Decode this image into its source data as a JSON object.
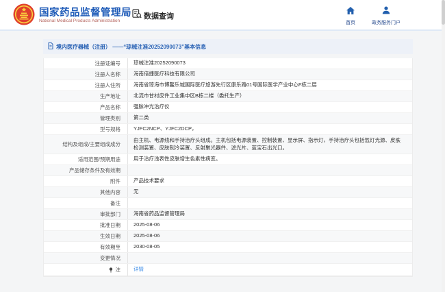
{
  "header": {
    "brand": {
      "title": "国家药品监督管理局",
      "subtitle": "National Medical Products Administration",
      "emblem_icon": "china-national-emblem"
    },
    "data_query": {
      "label": "数据查询",
      "icon": "doc-search-icon"
    },
    "nav": [
      {
        "label": "首页",
        "icon": "home-icon"
      },
      {
        "label": "政务服务门户",
        "icon": "user-icon"
      }
    ]
  },
  "breadcrumb": {
    "icon": "document-icon",
    "text": "境内医疗器械（注册） ——“琼械注准20252090073”基本信息"
  },
  "table": {
    "rows": [
      {
        "label": "注册证编号",
        "value": "琼械注准20252090073"
      },
      {
        "label": "注册人名称",
        "value": "海南倍捷医疗科技有限公司"
      },
      {
        "label": "注册人住所",
        "value": "海南省琼海市博鳌乐城国际医疗旅游先行区康乐路01号国际医学产业中心F栋二层"
      },
      {
        "label": "生产地址",
        "value": "北流市甘村皮件工业集中区B栋二楼（委托生产）"
      },
      {
        "label": "产品名称",
        "value": "强脉冲光治疗仪"
      },
      {
        "label": "管理类别",
        "value": "第二类"
      },
      {
        "label": "型号规格",
        "value": "YJFC2NCP、YJFC2DCP，"
      },
      {
        "label": "结构及组成/主要组成成分",
        "value": "由主机、电源线和手持治疗头组成。主机包括电源装置、控制装置、显示屏、指示灯，手持治疗头包括氙灯光源、皮肤检测装置、皮肤制冷装置、反射聚光器件、滤光片、蓝宝石出光口。",
        "tall": true
      },
      {
        "label": "适用范围/预期用途",
        "value": "用于治疗浅表性皮肤增生色素性病变。"
      },
      {
        "label": "产品储存条件及有效期",
        "value": ""
      },
      {
        "label": "附件",
        "value": "产品技术要求"
      },
      {
        "label": "其他内容",
        "value": "无"
      },
      {
        "label": "备注",
        "value": ""
      },
      {
        "label": "审批部门",
        "value": "海南省药品监督管理局"
      },
      {
        "label": "批准日期",
        "value": "2025-08-06"
      },
      {
        "label": "生效日期",
        "value": "2025-08-06"
      },
      {
        "label": "有效期至",
        "value": "2030-08-05"
      },
      {
        "label": "变更情况",
        "value": ""
      },
      {
        "label": "注",
        "label_icon": "pin-icon",
        "value": "详情",
        "link": true,
        "last": true
      }
    ]
  },
  "colors": {
    "brand_blue": "#1e5bb8",
    "subtitle_red": "#b5655f",
    "nav_blue": "#2360ae",
    "crumb_blue": "#2a63b5",
    "crumb_bg": "#edf1f8",
    "link_blue": "#3f8ee8",
    "stripe_gray": "#f7f8f9",
    "emblem_red": "#e03f2c",
    "emblem_gold": "#f9d03e"
  }
}
